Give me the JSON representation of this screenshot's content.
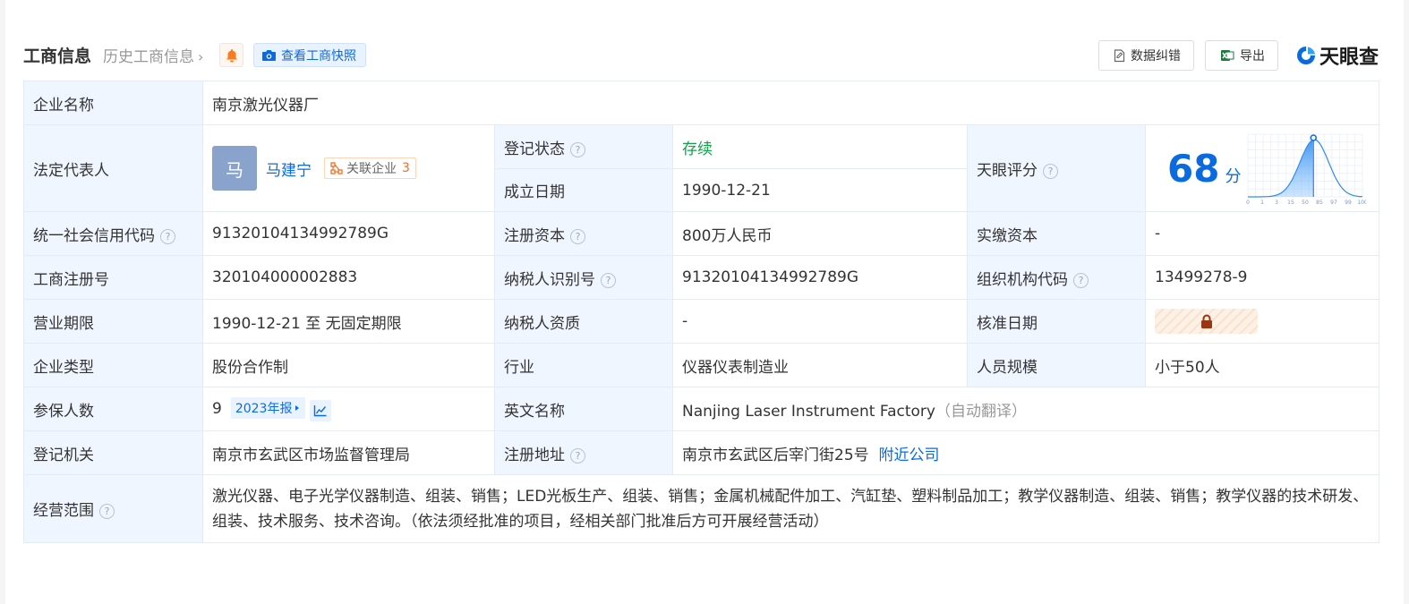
{
  "header": {
    "title": "工商信息",
    "history_link": "历史工商信息",
    "snapshot_button": "查看工商快照",
    "data_correction": "数据纠错",
    "export": "导出",
    "logo_text": "天眼查"
  },
  "colors": {
    "accent": "#0a6be1",
    "label_bg": "#f0f6ff",
    "status_green": "#12a34a",
    "orange": "#f56d1f"
  },
  "icons": {
    "history_chevron": "chevron-right-icon",
    "bell": "bell-icon",
    "camera": "camera-icon",
    "correction": "document-edit-icon",
    "export": "excel-icon",
    "logo": "tianyancha-logo-icon",
    "help": "question-circle-icon",
    "related": "network-icon",
    "trend": "line-chart-icon",
    "lock": "lock-icon",
    "report_arrow": "triangle-right-icon"
  },
  "rows": {
    "company_name": {
      "label": "企业名称",
      "value": "南京激光仪器厂"
    },
    "legal_rep": {
      "label": "法定代表人",
      "avatar_char": "马",
      "name": "马建宁",
      "related_label": "关联企业",
      "related_count": "3"
    },
    "reg_status": {
      "label": "登记状态",
      "value": "存续"
    },
    "found_date": {
      "label": "成立日期",
      "value": "1990-12-21"
    },
    "tianyan_score": {
      "label": "天眼评分",
      "value": "68",
      "unit": "分",
      "axis_ticks": [
        "0",
        "1",
        "3",
        "15",
        "50",
        "85",
        "97",
        "99",
        "100"
      ]
    },
    "credit_code": {
      "label": "统一社会信用代码",
      "value": "91320104134992789G"
    },
    "reg_capital": {
      "label": "注册资本",
      "value": "800万人民币"
    },
    "paid_capital": {
      "label": "实缴资本",
      "value": "-"
    },
    "biz_reg_no": {
      "label": "工商注册号",
      "value": "320104000002883"
    },
    "taxpayer_id": {
      "label": "纳税人识别号",
      "value": "91320104134992789G"
    },
    "org_code": {
      "label": "组织机构代码",
      "value": "13499278-9"
    },
    "biz_term": {
      "label": "营业期限",
      "value": "1990-12-21 至 无固定期限"
    },
    "taxpayer_qual": {
      "label": "纳税人资质",
      "value": "-"
    },
    "approval_date": {
      "label": "核准日期"
    },
    "company_type": {
      "label": "企业类型",
      "value": "股份合作制"
    },
    "industry": {
      "label": "行业",
      "value": "仪器仪表制造业"
    },
    "staff_size": {
      "label": "人员规模",
      "value": "小于50人"
    },
    "insured": {
      "label": "参保人数",
      "value": "9",
      "report": "2023年报"
    },
    "english_name": {
      "label": "英文名称",
      "value": "Nanjing Laser Instrument Factory",
      "note": "（自动翻译）"
    },
    "reg_authority": {
      "label": "登记机关",
      "value": "南京市玄武区市场监督管理局"
    },
    "reg_address": {
      "label": "注册地址",
      "value": "南京市玄武区后宰门街25号",
      "nearby": "附近公司"
    },
    "biz_scope": {
      "label": "经营范围",
      "value": "激光仪器、电子光学仪器制造、组装、销售；LED光板生产、组装、销售；金属机械配件加工、汽缸垫、塑料制品加工；教学仪器制造、组装、销售；教学仪器的技术研发、组装、技术服务、技术咨询。（依法须经批准的项目，经相关部门批准后方可开展经营活动）"
    }
  }
}
